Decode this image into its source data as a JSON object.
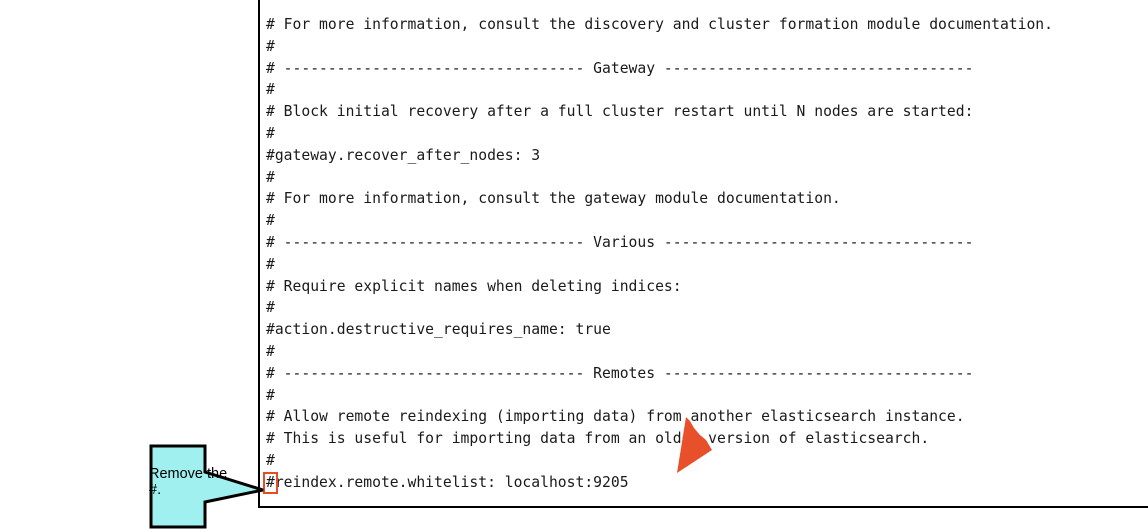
{
  "editor": {
    "lines": [
      "# For more information, consult the discovery and cluster formation module documentation.",
      "#",
      "# ---------------------------------- Gateway -----------------------------------",
      "#",
      "# Block initial recovery after a full cluster restart until N nodes are started:",
      "#",
      "#gateway.recover_after_nodes: 3",
      "#",
      "# For more information, consult the gateway module documentation.",
      "#",
      "# ---------------------------------- Various -----------------------------------",
      "#",
      "# Require explicit names when deleting indices:",
      "#",
      "#action.destructive_requires_name: true",
      "#",
      "# ---------------------------------- Remotes -----------------------------------",
      "#",
      "# Allow remote reindexing (importing data) from another elasticsearch instance.",
      "# This is useful for importing data from an older version of elasticsearch.",
      "#"
    ],
    "highlight_line": {
      "hash": "#",
      "rest": "reindex.remote.whitelist: localhost:9205"
    }
  },
  "callout": {
    "text": "Remove the #.",
    "fill_color": "#9ff0ef"
  },
  "arrow": {
    "color": "#e8502c"
  }
}
